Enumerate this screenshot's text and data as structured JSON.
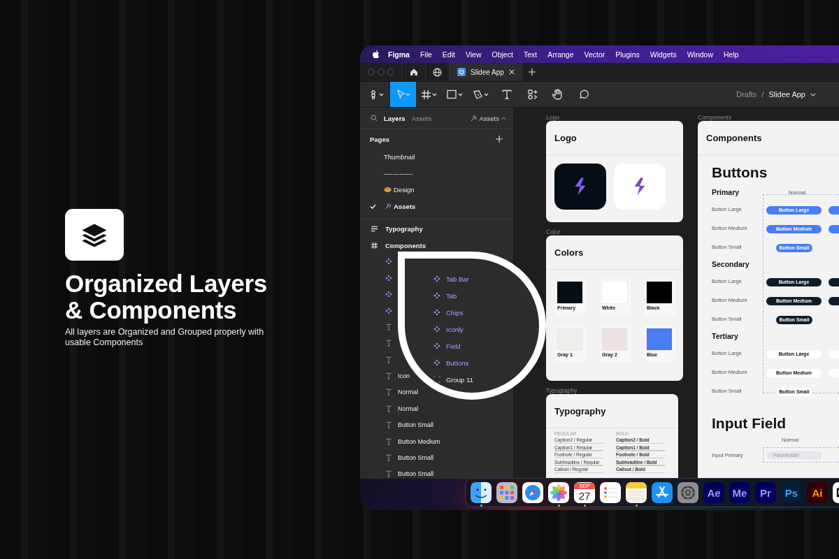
{
  "promo": {
    "title": "Organized Layers & Components",
    "subtitle": "All layers are Organized and Grouped properly with usable Components"
  },
  "menu_bar": {
    "app": "Figma",
    "items": [
      "File",
      "Edit",
      "View",
      "Object",
      "Text",
      "Arrange",
      "Vector",
      "Plugins",
      "Widgets",
      "Window",
      "Help"
    ]
  },
  "tabs": [
    {
      "label": "Slidee App",
      "selected": true
    }
  ],
  "toolbar": {
    "tools": [
      {
        "kind": "main-menu",
        "selected": false
      },
      {
        "kind": "move",
        "selected": true
      },
      {
        "kind": "frame",
        "selected": false
      },
      {
        "kind": "shape",
        "selected": false
      },
      {
        "kind": "pen",
        "selected": false
      },
      {
        "kind": "text",
        "selected": false
      },
      {
        "kind": "resources",
        "selected": false
      },
      {
        "kind": "hand",
        "selected": false
      },
      {
        "kind": "comment",
        "selected": false
      }
    ],
    "breadcrumb": {
      "folder": "Drafts",
      "separator": "/",
      "file": "Slidee App"
    }
  },
  "sidebar": {
    "tabs": [
      {
        "label": "Layers",
        "selected": true
      },
      {
        "label": "Assets",
        "selected": false
      }
    ],
    "page_picker": "Assets",
    "pages_heading": "Pages",
    "pages": [
      {
        "label": "Thumbnail",
        "kind": "plain",
        "selected": false
      },
      {
        "label": "-------------",
        "kind": "plain",
        "selected": false
      },
      {
        "label": "Design",
        "kind": "palette",
        "selected": false
      },
      {
        "label": "Assets",
        "kind": "hammer",
        "selected": true
      }
    ],
    "layers": [
      {
        "label": "Typography",
        "kind": "list"
      },
      {
        "label": "Components",
        "kind": "frame",
        "children": [
          {
            "kind": "component"
          },
          {
            "kind": "component"
          },
          {
            "kind": "component"
          },
          {
            "kind": "component"
          },
          {
            "kind": "text"
          },
          {
            "kind": "text"
          },
          {
            "kind": "text"
          },
          {
            "label": "Icon",
            "kind": "text"
          },
          {
            "label": "Normal",
            "kind": "text"
          },
          {
            "label": "Normal",
            "kind": "text"
          },
          {
            "label": "Button Small",
            "kind": "text"
          },
          {
            "label": "Button Medium",
            "kind": "text"
          },
          {
            "label": "Button Small",
            "kind": "text"
          },
          {
            "label": "Button Small",
            "kind": "text"
          }
        ]
      }
    ]
  },
  "magnifier": {
    "items": [
      {
        "label": "Tab Bar",
        "kind": "component"
      },
      {
        "label": "Tab",
        "kind": "component"
      },
      {
        "label": "Chips",
        "kind": "component"
      },
      {
        "label": "Iconly",
        "kind": "component"
      },
      {
        "label": "Field",
        "kind": "component"
      },
      {
        "label": "Buttons",
        "kind": "component"
      },
      {
        "label": "Group 11",
        "kind": "group"
      }
    ]
  },
  "canvas": {
    "logo_frame": {
      "label": "Logo",
      "title": "Logo",
      "tiles": [
        {
          "kind": "dark"
        },
        {
          "kind": "light"
        }
      ]
    },
    "color_frame": {
      "label": "Color",
      "title": "Colors",
      "swatches": [
        {
          "name": "Primary",
          "color": "#060d14"
        },
        {
          "name": "White",
          "color": "#ffffff"
        },
        {
          "name": "Black",
          "color": "#000000"
        },
        {
          "name": "Gray 1",
          "color": "#eeeeea"
        },
        {
          "name": "Gray 2",
          "color": "#ebe3e1"
        },
        {
          "name": "Blue",
          "color": "#4a7cf6"
        }
      ]
    },
    "typography_frame": {
      "label": "Typography",
      "title": "Typography",
      "columns": [
        {
          "heading": "REGULAR",
          "styles": [
            "Caption2 / Regular",
            "Caption1 / Regular",
            "Footnote / Regular",
            "Subheadline / Regular",
            "Callout / Regular"
          ]
        },
        {
          "heading": "BOLD",
          "styles": [
            "Caption2 / Bold",
            "Caption1 / Bold",
            "Footnote / Bold",
            "Subheadline / Bold",
            "Callout / Bold"
          ]
        }
      ]
    },
    "components_frame": {
      "label": "Components",
      "title": "Components",
      "buttons_heading": "Buttons",
      "state_heading": "Normal",
      "groups": [
        {
          "name": "Primary",
          "kind": "primary",
          "rows": [
            {
              "label": "Button Large",
              "button_text": "Button Large"
            },
            {
              "label": "Button Medium",
              "button_text": "Button Medium"
            },
            {
              "label": "Button Small",
              "button_text": "Button Small"
            }
          ]
        },
        {
          "name": "Secondary",
          "kind": "secondary",
          "rows": [
            {
              "label": "Button Large",
              "button_text": "Button Large"
            },
            {
              "label": "Button Medium",
              "button_text": "Button Medium"
            },
            {
              "label": "Button Small",
              "button_text": "Button Small"
            }
          ]
        },
        {
          "name": "Tertiary",
          "kind": "tertiary",
          "rows": [
            {
              "label": "Button Large",
              "button_text": "Button Large"
            },
            {
              "label": "Button Medium",
              "button_text": "Button Medium"
            },
            {
              "label": "Button Small",
              "button_text": "Button Small"
            }
          ]
        }
      ],
      "input_heading": "Input Field",
      "input_state_heading": "Normal",
      "inputs": [
        {
          "label": "Input Primary",
          "placeholder": "Placeholder"
        }
      ]
    }
  },
  "dock": {
    "items": [
      {
        "kind": "finder",
        "running": true
      },
      {
        "kind": "launchpad",
        "running": false
      },
      {
        "kind": "safari",
        "running": false
      },
      {
        "kind": "photos",
        "running": true
      },
      {
        "kind": "calendar",
        "running": true,
        "month": "SEP",
        "day": "27"
      },
      {
        "kind": "reminders",
        "running": false
      },
      {
        "kind": "notes",
        "running": true
      },
      {
        "kind": "app-store",
        "running": false
      },
      {
        "kind": "settings",
        "running": false
      },
      {
        "kind": "adobe",
        "label": "Ae",
        "color": "#9999ff",
        "running": false
      },
      {
        "kind": "adobe",
        "label": "Me",
        "color": "#9999ff",
        "running": false
      },
      {
        "kind": "adobe",
        "label": "Pr",
        "color": "#9999ff",
        "running": false
      },
      {
        "kind": "adobe",
        "label": "Ps",
        "color": "#31a8ff",
        "running": false
      },
      {
        "kind": "adobe",
        "label": "Ai",
        "color": "#ff9a00",
        "running": false
      },
      {
        "kind": "capcut",
        "running": false
      }
    ]
  }
}
